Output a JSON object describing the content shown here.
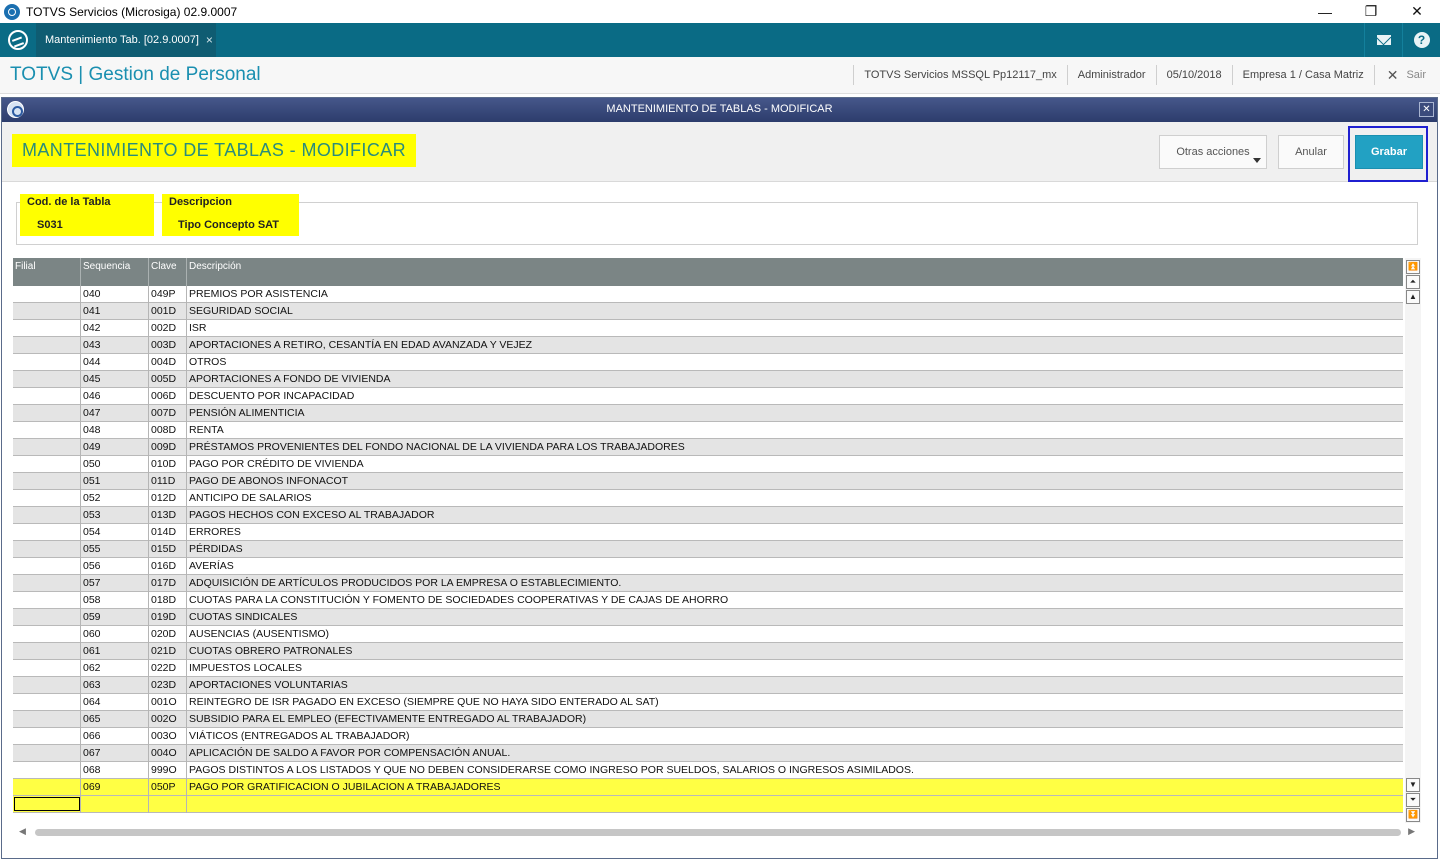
{
  "os_window": {
    "title": "TOTVS Servicios (Microsiga) 02.9.0007",
    "min": "—",
    "restore": "❐",
    "close": "✕"
  },
  "app_tab": {
    "label": "Mantenimiento Tab. [02.9.0007]",
    "close": "×"
  },
  "app_header": {
    "name": "TOTVS | Gestion de Personal",
    "environment": "TOTVS Servicios MSSQL Pp12117_mx",
    "user": "Administrador",
    "date": "05/10/2018",
    "company": "Empresa 1 / Casa Matriz",
    "exit": "Sair"
  },
  "dialog": {
    "title": "MANTENIMIENTO DE TABLAS - MODIFICAR",
    "page_title": "MANTENIMIENTO DE TABLAS - MODIFICAR",
    "buttons": {
      "otras": "Otras acciones",
      "anular": "Anular",
      "grabar": "Grabar"
    },
    "fields": {
      "cod_label": "Cod. de la Tabla",
      "cod_value": "S031",
      "desc_label": "Descripcion",
      "desc_value": "Tipo Concepto SAT"
    }
  },
  "grid": {
    "headers": [
      "Filial",
      "Sequencia",
      "Clave",
      "Descripción"
    ],
    "rows": [
      [
        "",
        "040",
        "049P",
        "PREMIOS POR ASISTENCIA"
      ],
      [
        "",
        "041",
        "001D",
        "SEGURIDAD SOCIAL"
      ],
      [
        "",
        "042",
        "002D",
        "ISR"
      ],
      [
        "",
        "043",
        "003D",
        "APORTACIONES A RETIRO, CESANTÍA EN EDAD AVANZADA Y VEJEZ"
      ],
      [
        "",
        "044",
        "004D",
        "OTROS"
      ],
      [
        "",
        "045",
        "005D",
        "APORTACIONES A FONDO DE VIVIENDA"
      ],
      [
        "",
        "046",
        "006D",
        "DESCUENTO POR INCAPACIDAD"
      ],
      [
        "",
        "047",
        "007D",
        "PENSIÓN ALIMENTICIA"
      ],
      [
        "",
        "048",
        "008D",
        "RENTA"
      ],
      [
        "",
        "049",
        "009D",
        "PRÉSTAMOS PROVENIENTES DEL FONDO NACIONAL DE LA VIVIENDA PARA LOS TRABAJADORES"
      ],
      [
        "",
        "050",
        "010D",
        "PAGO POR CRÉDITO DE VIVIENDA"
      ],
      [
        "",
        "051",
        "011D",
        "PAGO DE ABONOS INFONACOT"
      ],
      [
        "",
        "052",
        "012D",
        "ANTICIPO DE SALARIOS"
      ],
      [
        "",
        "053",
        "013D",
        "PAGOS HECHOS CON EXCESO AL TRABAJADOR"
      ],
      [
        "",
        "054",
        "014D",
        "ERRORES"
      ],
      [
        "",
        "055",
        "015D",
        "PÉRDIDAS"
      ],
      [
        "",
        "056",
        "016D",
        "AVERÍAS"
      ],
      [
        "",
        "057",
        "017D",
        "ADQUISICIÓN DE ARTÍCULOS PRODUCIDOS POR LA EMPRESA O ESTABLECIMIENTO."
      ],
      [
        "",
        "058",
        "018D",
        "CUOTAS PARA LA CONSTITUCIÓN Y FOMENTO DE SOCIEDADES COOPERATIVAS Y DE CAJAS DE AHORRO"
      ],
      [
        "",
        "059",
        "019D",
        "CUOTAS SINDICALES"
      ],
      [
        "",
        "060",
        "020D",
        "AUSENCIAS (AUSENTISMO)"
      ],
      [
        "",
        "061",
        "021D",
        "CUOTAS OBRERO PATRONALES"
      ],
      [
        "",
        "062",
        "022D",
        "IMPUESTOS LOCALES"
      ],
      [
        "",
        "063",
        "023D",
        "APORTACIONES VOLUNTARIAS"
      ],
      [
        "",
        "064",
        "001O",
        "REINTEGRO DE ISR PAGADO EN EXCESO (SIEMPRE QUE NO HAYA SIDO ENTERADO AL SAT)"
      ],
      [
        "",
        "065",
        "002O",
        "SUBSIDIO PARA EL EMPLEO (EFECTIVAMENTE ENTREGADO AL TRABAJADOR)"
      ],
      [
        "",
        "066",
        "003O",
        "VIÁTICOS (ENTREGADOS AL TRABAJADOR)"
      ],
      [
        "",
        "067",
        "004O",
        "APLICACIÓN DE SALDO A FAVOR POR COMPENSACIÓN ANUAL."
      ],
      [
        "",
        "068",
        "999O",
        "PAGOS DISTINTOS A LOS LISTADOS Y QUE NO DEBEN CONSIDERARSE COMO INGRESO POR SUELDOS, SALARIOS O INGRESOS ASIMILADOS."
      ],
      [
        "",
        "069",
        "050P",
        "PAGO POR GRATIFICACION O JUBILACION A TRABAJADORES"
      ],
      [
        "",
        "",
        "",
        ""
      ]
    ],
    "highlighted_rows": [
      29,
      30
    ]
  },
  "colors": {
    "accent": "#0a6b85",
    "highlight": "#ffff00",
    "grabar": "#22a1c3"
  }
}
